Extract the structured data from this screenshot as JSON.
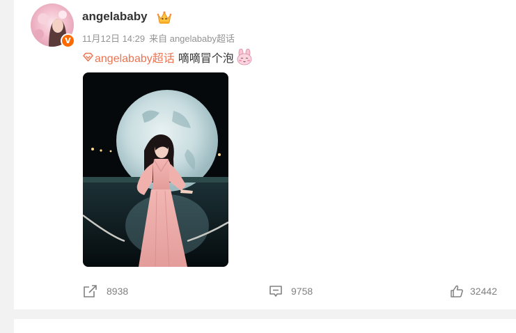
{
  "post": {
    "username": "angelababy",
    "timestamp": "11月12日 14:29",
    "source": "来自 angelababy超话",
    "topic_label": "angelababy超话",
    "text": "嘀嘀冒个泡",
    "icons": {
      "verified": "verified-v-badge-icon",
      "crown": "crown-icon",
      "topic": "super-topic-diamond-icon",
      "emoji": "pink-bunny-emoji-icon",
      "share": "share-icon",
      "comment": "comment-icon",
      "like": "thumbs-up-icon"
    },
    "colors": {
      "topic": "#eb7350",
      "verified_badge": "#ff6a00",
      "meta_text": "#939393"
    }
  },
  "actions": {
    "share_count": "8938",
    "comment_count": "9758",
    "like_count": "32442"
  }
}
